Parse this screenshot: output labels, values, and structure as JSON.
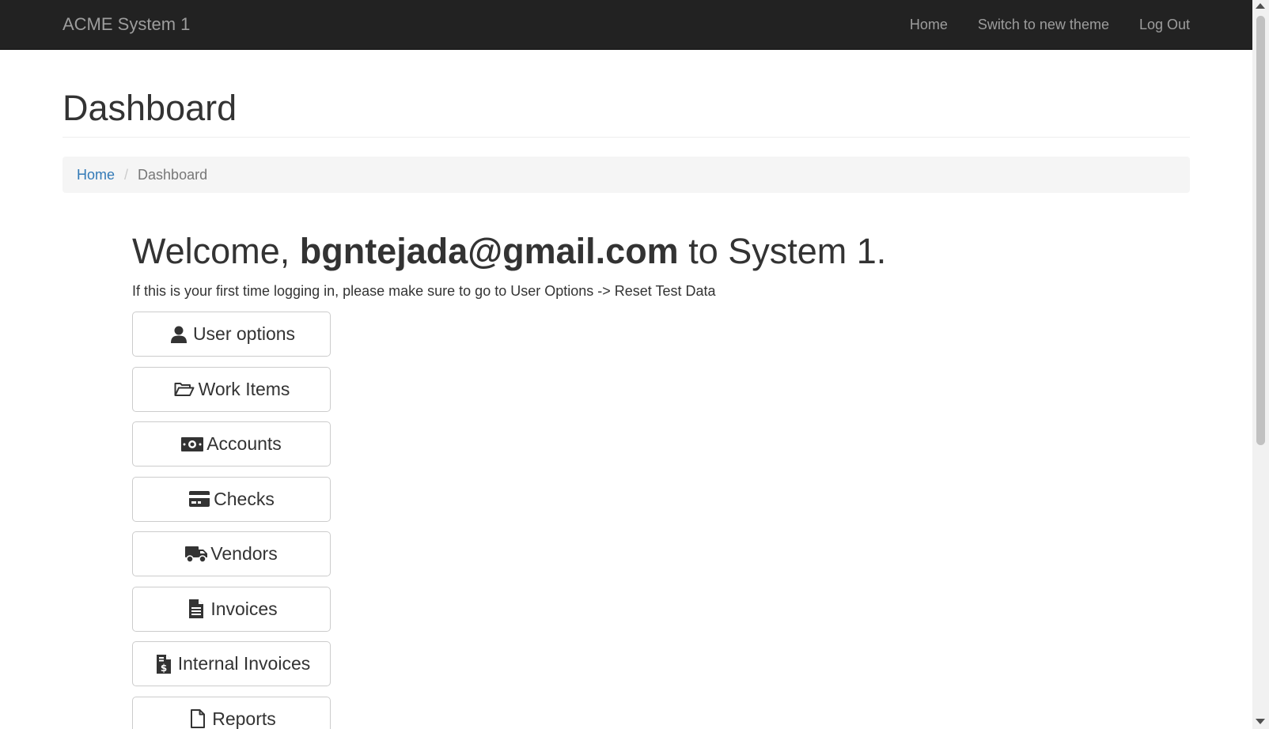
{
  "navbar": {
    "brand": "ACME System 1",
    "links": [
      "Home",
      "Switch to new theme",
      "Log Out"
    ]
  },
  "page": {
    "title": "Dashboard"
  },
  "breadcrumb": {
    "home": "Home",
    "separator": "/",
    "current": "Dashboard"
  },
  "welcome": {
    "prefix": "Welcome, ",
    "email": "bgntejada@gmail.com",
    "suffix": " to System 1.",
    "info": "If this is your first time logging in, please make sure to go to User Options -> Reset Test Data"
  },
  "buttons": [
    {
      "label": "User options",
      "icon": "user-icon"
    },
    {
      "label": "Work Items",
      "icon": "folder-open-icon"
    },
    {
      "label": "Accounts",
      "icon": "money-icon"
    },
    {
      "label": "Checks",
      "icon": "credit-card-icon"
    },
    {
      "label": "Vendors",
      "icon": "truck-icon"
    },
    {
      "label": "Invoices",
      "icon": "file-text-icon"
    },
    {
      "label": "Internal Invoices",
      "icon": "file-dollar-icon"
    },
    {
      "label": "Reports",
      "icon": "file-icon"
    }
  ]
}
